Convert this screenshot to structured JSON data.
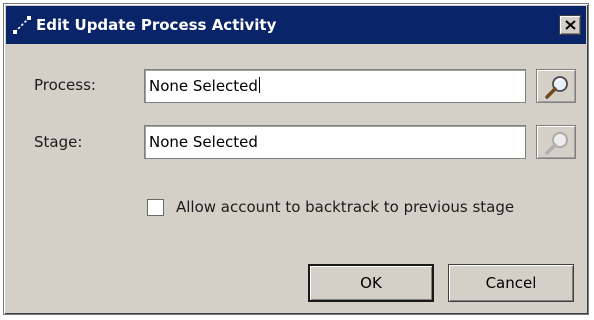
{
  "dialog": {
    "title": "Edit Update Process Activity",
    "title_icon": "connector-icon",
    "close_icon": "close-icon"
  },
  "form": {
    "process": {
      "label": "Process:",
      "value": "None Selected",
      "lookup_icon": "magnifier-icon",
      "lookup_enabled": true
    },
    "stage": {
      "label": "Stage:",
      "value": "None Selected",
      "lookup_icon": "magnifier-icon",
      "lookup_enabled": false
    },
    "backtrack": {
      "label": "Allow account to backtrack to previous stage",
      "checked": false
    }
  },
  "buttons": {
    "ok_label": "OK",
    "cancel_label": "Cancel"
  },
  "colors": {
    "titlebar": "#0a246a",
    "dialog_bg": "#d4d0c8"
  }
}
